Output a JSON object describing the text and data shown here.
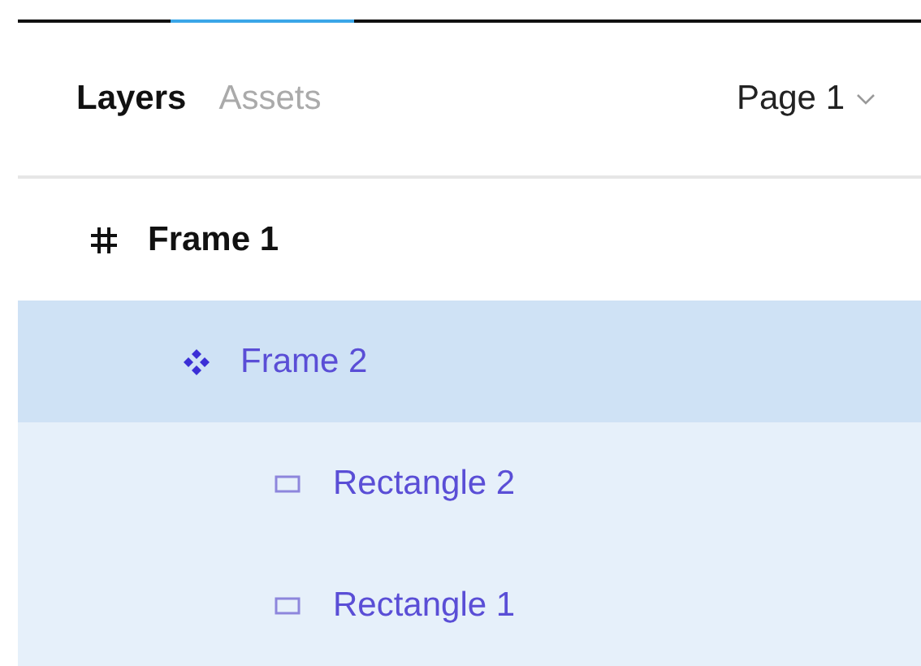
{
  "tabs": [
    {
      "label": "Layers",
      "selected": true
    },
    {
      "label": "Assets",
      "selected": false
    }
  ],
  "page_selector": {
    "label": "Page 1"
  },
  "layers": [
    {
      "name": "Frame 1",
      "kind": "frame",
      "selected": false,
      "children": [
        {
          "name": "Frame 2",
          "kind": "component",
          "selected": true,
          "children": [
            {
              "name": "Rectangle 2",
              "kind": "rectangle",
              "selected": false
            },
            {
              "name": "Rectangle 1",
              "kind": "rectangle",
              "selected": false
            }
          ]
        }
      ]
    }
  ]
}
